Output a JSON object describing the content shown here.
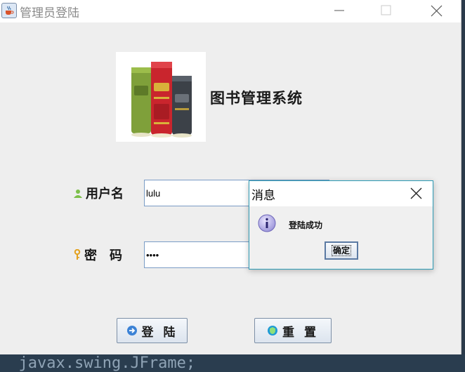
{
  "window": {
    "title": "管理员登陆",
    "app_title": "图书管理系统"
  },
  "form": {
    "username_label": "用户名",
    "username_value": "lulu",
    "password_label": "密　码",
    "password_value": "••••",
    "login_button": "登 陆",
    "reset_button": "重 置"
  },
  "dialog": {
    "title": "消息",
    "message": "登陆成功",
    "ok_button": "确定"
  },
  "background": {
    "text": "javax.swing.JFrame;"
  },
  "icons": {
    "app": "java-cup-icon",
    "logo": "books-logo",
    "user": "user-icon",
    "password": "key-icon",
    "login": "login-arrow-icon",
    "reset": "reset-shield-icon",
    "info": "info-icon"
  },
  "colors": {
    "dialog_border": "#2c9bb5",
    "field_border": "#7a9cc6",
    "window_bg": "#eeeeee"
  }
}
